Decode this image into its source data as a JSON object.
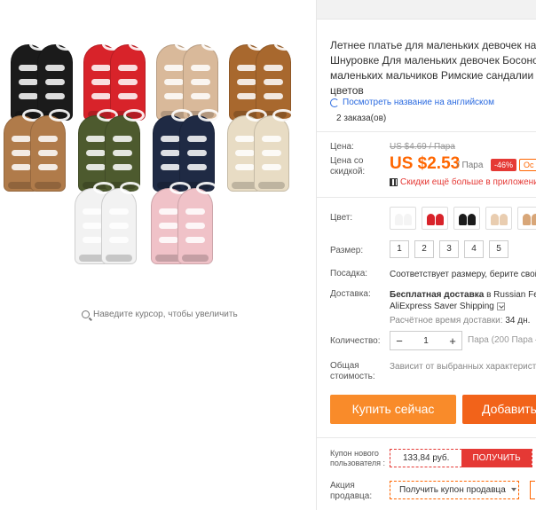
{
  "gallery": {
    "zoom_hint": "Наведите курсор, чтобы увеличить",
    "shoes": [
      {
        "color": "#1b1b1b"
      },
      {
        "color": "#d8232a"
      },
      {
        "color": "#d9b99a"
      },
      {
        "color": "#a8682e"
      },
      {
        "color": "#b07b4a"
      },
      {
        "color": "#4d5a2e"
      },
      {
        "color": "#1f2a44"
      },
      {
        "color": "#e8dcc4"
      },
      {
        "color": "#f2f2f2"
      },
      {
        "color": "#f0c2c8"
      }
    ]
  },
  "product": {
    "title": "Летнее платье для маленьких девочек на Шнуровке Для маленьких девочек Босоно маленьких мальчиков Римские сандалии цветов",
    "translate_link": "Посмотреть название на английском",
    "orders": "2 заказа(ов)"
  },
  "pricing": {
    "price_label": "Цена:",
    "original_price": "US $4.69 / Пара",
    "discount_label": "Цена со скидкой:",
    "price": "US $2.53",
    "unit": "/ Пара",
    "discount": "-46%",
    "badge": "Ос",
    "promo_text": "Скидки ещё больше в приложении"
  },
  "options": {
    "color_label": "Цвет:",
    "color_swatches": [
      {
        "name": "white",
        "color": "#f4f4f4"
      },
      {
        "name": "red",
        "color": "#d8232a"
      },
      {
        "name": "black",
        "color": "#1b1b1b"
      },
      {
        "name": "beige",
        "color": "#e9cdb0"
      },
      {
        "name": "tan",
        "color": "#d8a678"
      }
    ],
    "size_label": "Размер:",
    "sizes": [
      "1",
      "2",
      "3",
      "4",
      "5"
    ],
    "fit_label": "Посадка:",
    "fit_value": "Соответствует размеру, берите свой"
  },
  "shipping": {
    "label": "Доставка:",
    "prefix": "Бесплатная доставка",
    "suffix": "в Russian Fed",
    "method": "AliExpress Saver Shipping",
    "eta_label": "Расчётное время доставки:",
    "eta_value": "34 дн."
  },
  "quantity": {
    "label": "Количество:",
    "minus": "−",
    "value": "1",
    "plus": "+",
    "note": "Пара (200 Пара –"
  },
  "total": {
    "label": "Общая стоимость:",
    "value": "Зависит от выбранных характеристи"
  },
  "actions": {
    "buy_now": "Купить сейчас",
    "add_to_cart": "Добавить"
  },
  "coupons": {
    "new_user_label": "Купон нового пользователя :",
    "new_user_amount": "133,84 руб.",
    "new_user_button": "ПОЛУЧИТЬ",
    "seller_label": "Акция продавца:",
    "seller_button": "Получить купон продавца"
  }
}
